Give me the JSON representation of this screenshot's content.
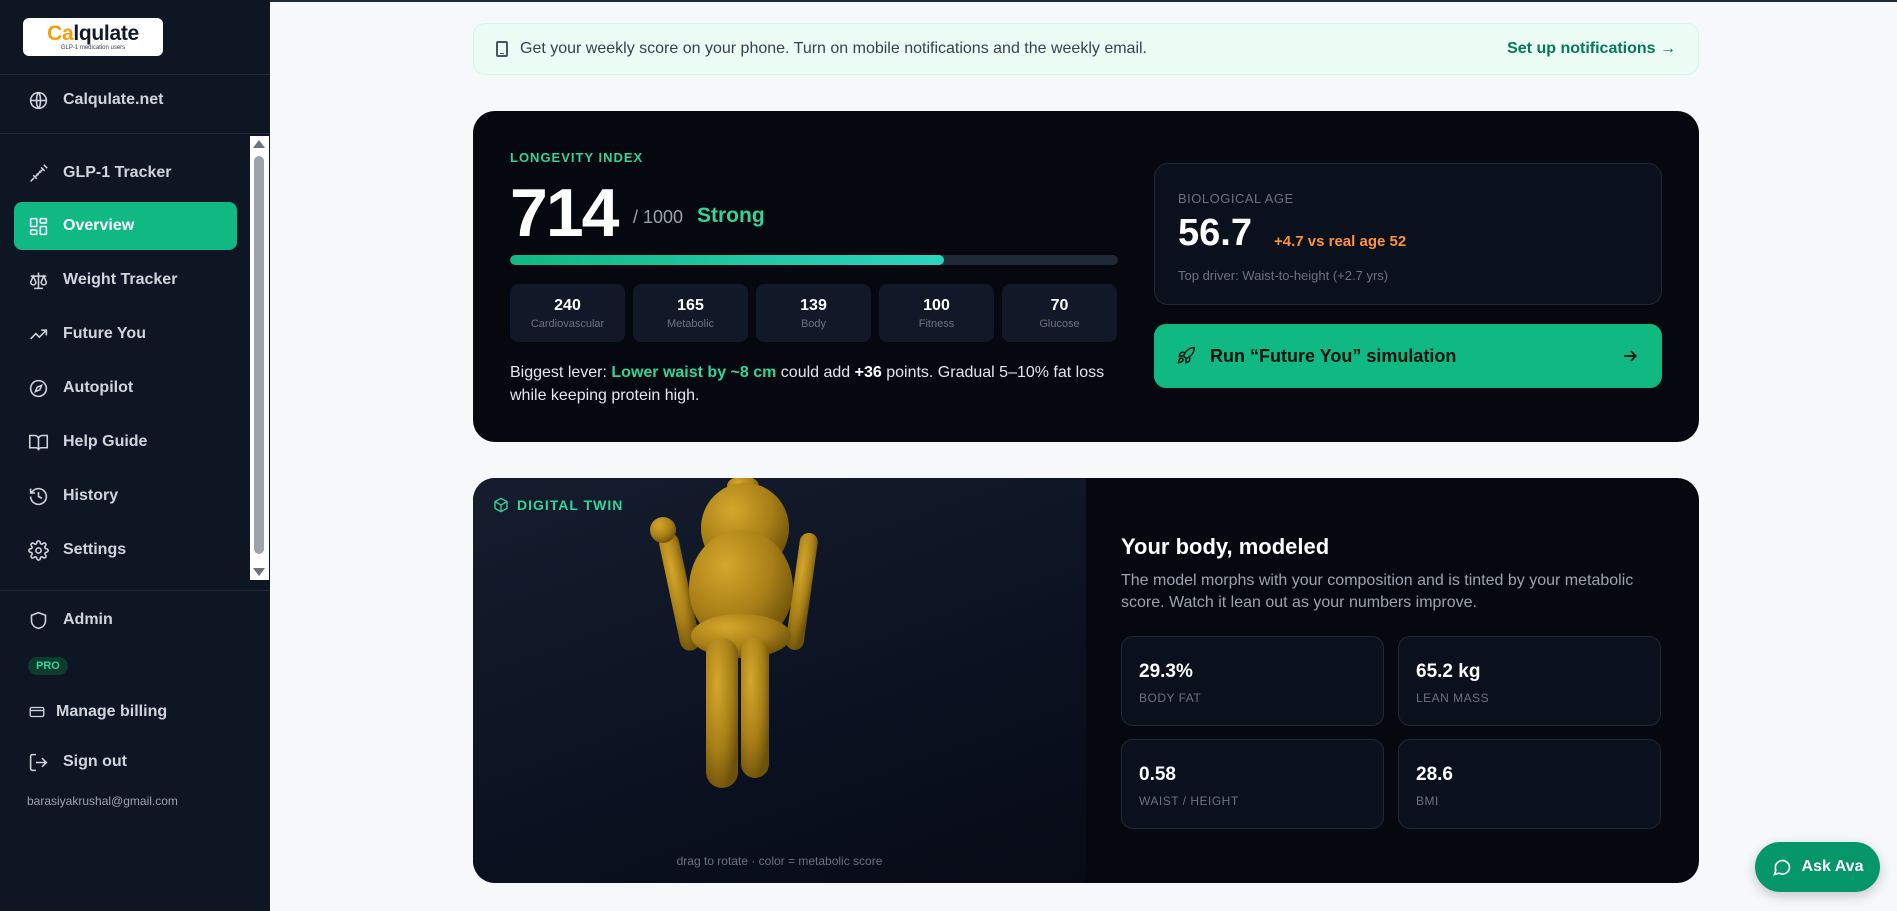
{
  "brand": {
    "name_part1": "Ca",
    "name_part2": "lqulate",
    "tagline": "GLP-1 medication users"
  },
  "sidebar": {
    "top_link": "Calqulate.net",
    "items": [
      {
        "label": "GLP-1 Tracker",
        "icon": "syringe-icon"
      },
      {
        "label": "Overview",
        "icon": "dashboard-icon",
        "active": true
      },
      {
        "label": "Weight Tracker",
        "icon": "scale-icon"
      },
      {
        "label": "Future You",
        "icon": "trending-up-icon"
      },
      {
        "label": "Autopilot",
        "icon": "compass-icon"
      },
      {
        "label": "Help Guide",
        "icon": "book-icon"
      },
      {
        "label": "History",
        "icon": "history-icon"
      },
      {
        "label": "Settings",
        "icon": "gear-icon"
      }
    ],
    "admin": "Admin",
    "pro_badge": "PRO",
    "billing": "Manage billing",
    "signout": "Sign out",
    "email": "barasiyakrushal@gmail.com"
  },
  "banner": {
    "text": "Get your weekly score on your phone. Turn on mobile notifications and the weekly email.",
    "link": "Set up notifications →"
  },
  "longevity": {
    "label": "LONGEVITY INDEX",
    "score": "714",
    "total": "/ 1000",
    "status": "Strong",
    "progress": 0.714,
    "subscores": [
      {
        "value": "240",
        "label": "Cardiovascular"
      },
      {
        "value": "165",
        "label": "Metabolic"
      },
      {
        "value": "139",
        "label": "Body"
      },
      {
        "value": "100",
        "label": "Fitness"
      },
      {
        "value": "70",
        "label": "Glucose"
      }
    ],
    "lever_prefix": "Biggest lever: ",
    "lever_highlight": "Lower waist by ~8 cm",
    "lever_mid": " could add ",
    "lever_points": "+36",
    "lever_suffix": " points. Gradual 5–10% fat loss while keeping protein high."
  },
  "bio_age": {
    "label": "BIOLOGICAL AGE",
    "value": "56.7",
    "delta": "+4.7 vs real age 52",
    "driver": "Top driver: Waist-to-height (+2.7 yrs)"
  },
  "run_button": "Run “Future You” simulation",
  "twin": {
    "label": "DIGITAL TWIN",
    "hint": "drag to rotate · color = metabolic score",
    "title": "Your body, modeled",
    "description": "The model morphs with your composition and is tinted by your metabolic score. Watch it lean out as your numbers improve.",
    "body_color": "#b8901f",
    "metrics": [
      {
        "value": "29.3%",
        "label": "BODY FAT"
      },
      {
        "value": "65.2 kg",
        "label": "LEAN MASS"
      },
      {
        "value": "0.58",
        "label": "WAIST / HEIGHT"
      },
      {
        "value": "28.6",
        "label": "BMI"
      }
    ]
  },
  "ask_ava": "Ask Ava",
  "colors": {
    "accent": "#10b981",
    "sidebar_bg": "#0f1623",
    "card_bg": "#05080f",
    "warning": "#fb923c"
  }
}
